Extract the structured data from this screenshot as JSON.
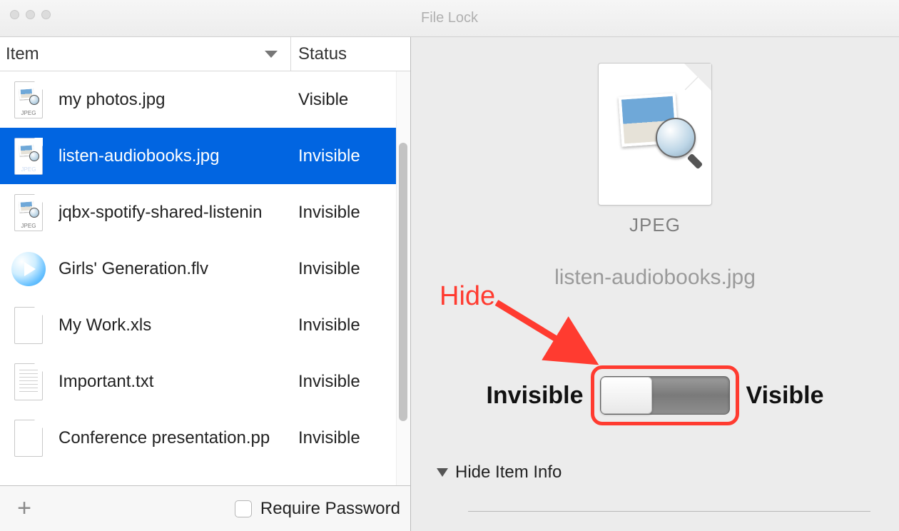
{
  "window": {
    "title": "File Lock"
  },
  "columns": {
    "item": "Item",
    "status": "Status"
  },
  "rows": [
    {
      "name": "my photos.jpg",
      "status": "Visible",
      "icon": "jpeg",
      "selected": false
    },
    {
      "name": "listen-audiobooks.jpg",
      "status": "Invisible",
      "icon": "jpeg",
      "selected": true
    },
    {
      "name": "jqbx-spotify-shared-listenin",
      "status": "Invisible",
      "icon": "jpeg",
      "selected": false
    },
    {
      "name": "Girls' Generation.flv",
      "status": "Invisible",
      "icon": "video",
      "selected": false
    },
    {
      "name": "My Work.xls",
      "status": "Invisible",
      "icon": "blank",
      "selected": false
    },
    {
      "name": "Important.txt",
      "status": "Invisible",
      "icon": "text",
      "selected": false
    },
    {
      "name": "Conference presentation.pp",
      "status": "Invisible",
      "icon": "blank",
      "selected": false
    }
  ],
  "bottom": {
    "require_password": "Require Password"
  },
  "detail": {
    "format_label": "JPEG",
    "filename": "listen-audiobooks.jpg",
    "invisible": "Invisible",
    "visible": "Visible",
    "hide_info": "Hide Item Info"
  },
  "annotation": {
    "hide": "Hide",
    "color": "#ff3b30"
  }
}
